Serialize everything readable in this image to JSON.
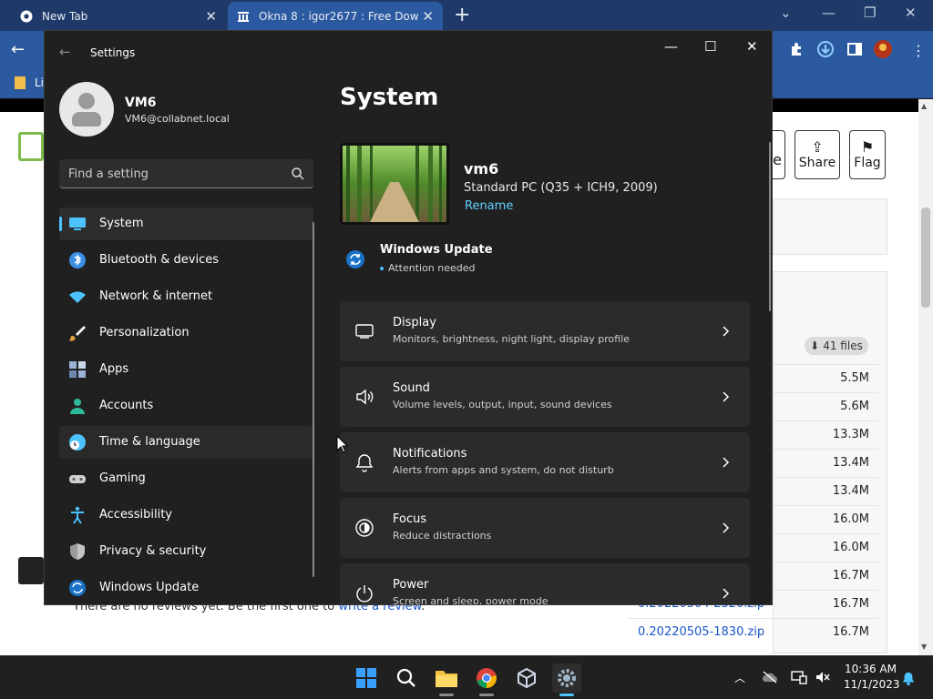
{
  "browser": {
    "tabs": [
      {
        "title": "New Tab"
      },
      {
        "title": "Okna 8 : igor2677 : Free Downlo"
      }
    ],
    "bookmark_label": "Li"
  },
  "webpage": {
    "buttons": [
      {
        "label": "e"
      },
      {
        "label": "Share"
      },
      {
        "label": "Flag"
      }
    ],
    "files_badge": "41 files",
    "file_rows": [
      {
        "name": "",
        "size": "5.5M"
      },
      {
        "name": "",
        "size": "5.6M"
      },
      {
        "name": "",
        "size": "13.3M"
      },
      {
        "name": "",
        "size": "13.4M"
      },
      {
        "name": "",
        "size": "13.4M"
      },
      {
        "name": "",
        "size": "16.0M"
      },
      {
        "name": "",
        "size": "16.0M"
      },
      {
        "name": "",
        "size": "16.7M"
      },
      {
        "name": "0.20220504-2320.zip",
        "size": "16.7M"
      },
      {
        "name": "0.20220505-1830.zip",
        "size": "16.7M"
      }
    ],
    "review_text": "There are no reviews yet. Be the first one to ",
    "review_link": "write a review",
    "review_end": "."
  },
  "settings": {
    "window_title": "Settings",
    "user": {
      "name": "VM6",
      "email": "VM6@collabnet.local"
    },
    "search": {
      "placeholder": "Find a setting"
    },
    "nav": [
      {
        "label": "System",
        "icon": "system-icon",
        "color": "#4cc2ff"
      },
      {
        "label": "Bluetooth & devices",
        "icon": "bluetooth-icon",
        "color": "#3a8ee6"
      },
      {
        "label": "Network & internet",
        "icon": "wifi-icon",
        "color": "#4cc2ff"
      },
      {
        "label": "Personalization",
        "icon": "brush-icon",
        "color": "#e8a43c"
      },
      {
        "label": "Apps",
        "icon": "apps-icon",
        "color": "#9ab3d5"
      },
      {
        "label": "Accounts",
        "icon": "accounts-icon",
        "color": "#2fb99a"
      },
      {
        "label": "Time & language",
        "icon": "globe-clock-icon",
        "color": "#4cc2ff"
      },
      {
        "label": "Gaming",
        "icon": "gamepad-icon",
        "color": "#cfcfcf"
      },
      {
        "label": "Accessibility",
        "icon": "accessibility-icon",
        "color": "#4cc2ff"
      },
      {
        "label": "Privacy & security",
        "icon": "shield-icon",
        "color": "#9a9a9a"
      },
      {
        "label": "Windows Update",
        "icon": "update-icon",
        "color": "#4cc2ff"
      }
    ],
    "page_title": "System",
    "device": {
      "name": "vm6",
      "model": "Standard PC (Q35 + ICH9, 2009)",
      "rename": "Rename"
    },
    "windows_update": {
      "title": "Windows Update",
      "status": "Attention needed"
    },
    "cards": [
      {
        "title": "Display",
        "subtitle": "Monitors, brightness, night light, display profile",
        "icon": "display-icon"
      },
      {
        "title": "Sound",
        "subtitle": "Volume levels, output, input, sound devices",
        "icon": "speaker-icon"
      },
      {
        "title": "Notifications",
        "subtitle": "Alerts from apps and system, do not disturb",
        "icon": "bell-icon"
      },
      {
        "title": "Focus",
        "subtitle": "Reduce distractions",
        "icon": "focus-icon"
      },
      {
        "title": "Power",
        "subtitle": "Screen and sleep, power mode",
        "icon": "power-icon"
      }
    ]
  },
  "taskbar": {
    "time": "10:36 AM",
    "date": "11/1/2023"
  },
  "colors": {
    "accent": "#4cc2ff",
    "window_bg": "#202020",
    "card_bg": "#2b2b2b",
    "browser_tab": "#2c5aa0"
  }
}
